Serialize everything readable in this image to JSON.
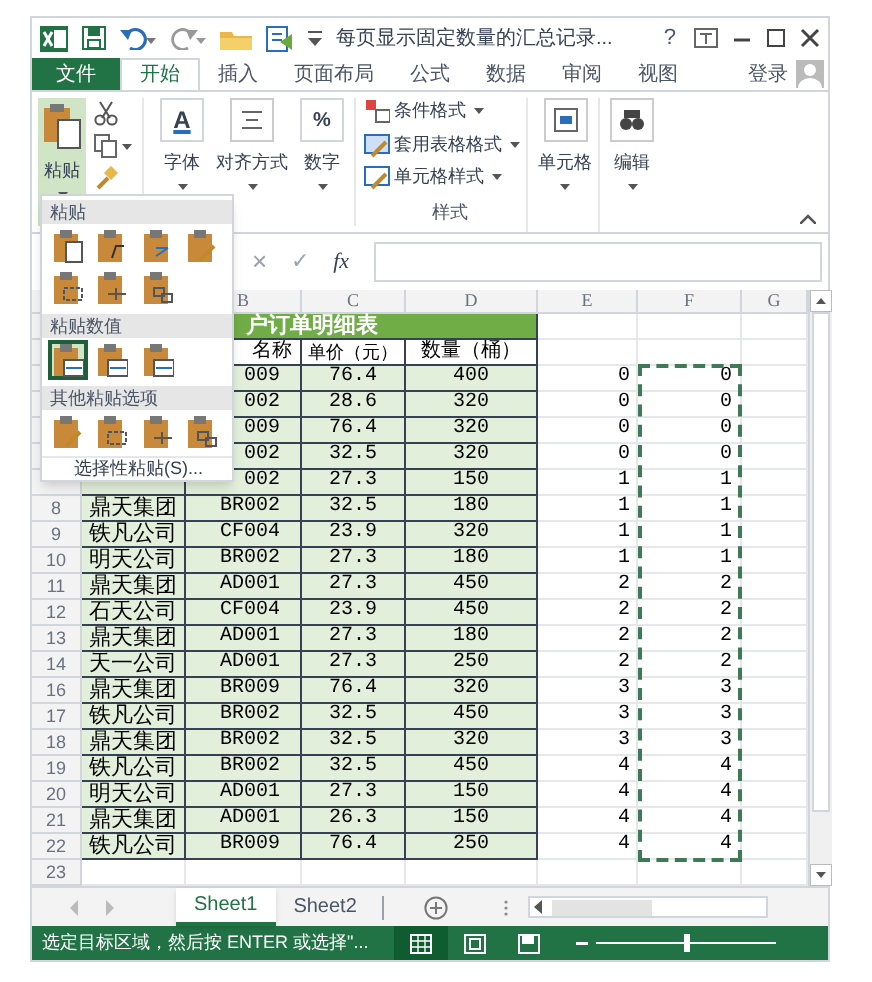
{
  "window": {
    "title": "每页显示固定数量的汇总记录...",
    "help": "?"
  },
  "ribbon_tabs": [
    {
      "label": "文件",
      "kind": "file",
      "selected": false
    },
    {
      "label": "开始",
      "kind": "tab",
      "selected": true
    },
    {
      "label": "插入",
      "kind": "tab",
      "selected": false
    },
    {
      "label": "页面布局",
      "kind": "tab",
      "selected": false
    },
    {
      "label": "公式",
      "kind": "tab",
      "selected": false
    },
    {
      "label": "数据",
      "kind": "tab",
      "selected": false
    },
    {
      "label": "审阅",
      "kind": "tab",
      "selected": false
    },
    {
      "label": "视图",
      "kind": "tab",
      "selected": false
    }
  ],
  "account": "登录",
  "ribbon": {
    "paste": "粘贴",
    "font": {
      "glyph": "A",
      "label": "字体"
    },
    "alignment": {
      "label": "对齐方式"
    },
    "number": {
      "glyph": "%",
      "label": "数字"
    },
    "styles": [
      "条件格式",
      "套用表格格式",
      "单元格样式"
    ],
    "styles_group": "样式",
    "cells": "单元格",
    "editing": "编辑"
  },
  "paste_menu": {
    "sections": [
      {
        "title": "粘贴",
        "options": [
          {
            "selected": false
          },
          {
            "selected": false
          },
          {
            "selected": false
          },
          {
            "selected": false
          },
          {
            "selected": false
          },
          {
            "selected": false
          },
          {
            "selected": false
          }
        ]
      },
      {
        "title": "粘贴数值",
        "options": [
          {
            "selected": true
          },
          {
            "selected": false
          },
          {
            "selected": false
          }
        ]
      },
      {
        "title": "其他粘贴选项",
        "options": [
          {
            "selected": false
          },
          {
            "selected": false
          },
          {
            "selected": false
          },
          {
            "selected": false
          }
        ]
      }
    ],
    "paste_special": "选择性粘贴(S)..."
  },
  "formula_bar": {
    "cancel": "×",
    "enter": "✓",
    "function": "fx"
  },
  "columns": [
    "B",
    "C",
    "D",
    "E",
    "F",
    "G"
  ],
  "rows": [
    {
      "kind": "title",
      "text": "户订单明细表"
    },
    {
      "kind": "header",
      "b": "名称",
      "c": "单价（元）",
      "d": "数量（桶）"
    },
    {
      "kind": "data",
      "b": "009",
      "c": "76.4",
      "d": "400",
      "e": "0",
      "f": "0"
    },
    {
      "kind": "data",
      "b": "002",
      "c": "28.6",
      "d": "320",
      "e": "0",
      "f": "0"
    },
    {
      "kind": "data",
      "b": "009",
      "c": "76.4",
      "d": "320",
      "e": "0",
      "f": "0"
    },
    {
      "kind": "data",
      "b": "002",
      "c": "32.5",
      "d": "320",
      "e": "0",
      "f": "0"
    },
    {
      "kind": "data",
      "b": "002",
      "c": "27.3",
      "d": "150",
      "e": "1",
      "f": "1"
    },
    {
      "kind": "data",
      "num": "8",
      "a": "鼎天集团",
      "b": "BR002",
      "c": "32.5",
      "d": "180",
      "e": "1",
      "f": "1"
    },
    {
      "kind": "data",
      "num": "9",
      "a": "铁凡公司",
      "b": "CF004",
      "c": "23.9",
      "d": "320",
      "e": "1",
      "f": "1"
    },
    {
      "kind": "data",
      "num": "10",
      "a": "明天公司",
      "b": "BR002",
      "c": "27.3",
      "d": "180",
      "e": "1",
      "f": "1"
    },
    {
      "kind": "data",
      "num": "11",
      "a": "鼎天集团",
      "b": "AD001",
      "c": "27.3",
      "d": "450",
      "e": "2",
      "f": "2"
    },
    {
      "kind": "data",
      "num": "12",
      "a": "石天公司",
      "b": "CF004",
      "c": "23.9",
      "d": "450",
      "e": "2",
      "f": "2"
    },
    {
      "kind": "data",
      "num": "13",
      "a": "鼎天集团",
      "b": "AD001",
      "c": "27.3",
      "d": "180",
      "e": "2",
      "f": "2"
    },
    {
      "kind": "data",
      "num": "14",
      "a": "天一公司",
      "b": "AD001",
      "c": "27.3",
      "d": "250",
      "e": "2",
      "f": "2"
    },
    {
      "kind": "data",
      "num": "16",
      "a": "鼎天集团",
      "b": "BR009",
      "c": "76.4",
      "d": "320",
      "e": "3",
      "f": "3"
    },
    {
      "kind": "data",
      "num": "17",
      "a": "铁凡公司",
      "b": "BR002",
      "c": "32.5",
      "d": "450",
      "e": "3",
      "f": "3"
    },
    {
      "kind": "data",
      "num": "18",
      "a": "鼎天集团",
      "b": "BR002",
      "c": "32.5",
      "d": "320",
      "e": "3",
      "f": "3"
    },
    {
      "kind": "data",
      "num": "19",
      "a": "铁凡公司",
      "b": "BR002",
      "c": "32.5",
      "d": "450",
      "e": "4",
      "f": "4"
    },
    {
      "kind": "data",
      "num": "20",
      "a": "明天公司",
      "b": "AD001",
      "c": "27.3",
      "d": "150",
      "e": "4",
      "f": "4"
    },
    {
      "kind": "data",
      "num": "21",
      "a": "鼎天集团",
      "b": "AD001",
      "c": "26.3",
      "d": "150",
      "e": "4",
      "f": "4"
    },
    {
      "kind": "data",
      "num": "22",
      "a": "铁凡公司",
      "b": "BR009",
      "c": "76.4",
      "d": "250",
      "e": "4",
      "f": "4"
    },
    {
      "kind": "empty",
      "num": "23"
    }
  ],
  "sheet_tabs": [
    {
      "label": "Sheet1",
      "selected": true
    },
    {
      "label": "Sheet2",
      "selected": false
    }
  ],
  "status_bar": {
    "message": "选定目标区域，然后按 ENTER 或选择\"...",
    "views": [
      {
        "selected": true
      },
      {
        "selected": false
      },
      {
        "selected": false
      }
    ],
    "zoom": {
      "level": 0.5
    }
  }
}
